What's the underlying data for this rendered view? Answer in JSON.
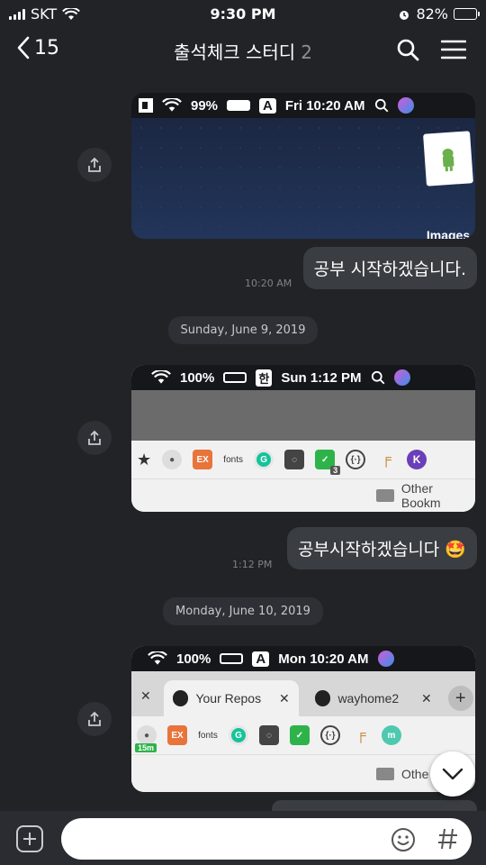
{
  "status": {
    "carrier": "SKT",
    "time": "9:30 PM",
    "battery": "82%",
    "battery_level": 0.82
  },
  "header": {
    "back_count": "15",
    "title": "출석체크 스터디",
    "member_count": "2"
  },
  "messages": [
    {
      "screenshot": {
        "menubar": {
          "battery": "99%",
          "input": "A",
          "clock": "Fri 10:20 AM"
        },
        "desktop_label": "Images"
      },
      "bubble": "공부 시작하겠습니다.",
      "time": "10:20 AM"
    },
    {
      "date": "Sunday, June 9, 2019",
      "screenshot": {
        "menubar": {
          "battery": "100%",
          "input": "한",
          "clock": "Sun 1:12 PM"
        },
        "bookmark_folder": "Other Bookm",
        "badge": "3"
      },
      "bubble": "공부시작하겠습니다 🤩",
      "time": "1:12 PM"
    },
    {
      "date": "Monday, June 10, 2019",
      "screenshot": {
        "menubar": {
          "battery": "100%",
          "input": "A",
          "clock": "Mon 10:20 AM"
        },
        "tab1": "Your Repos",
        "tab2": "wayhome2",
        "bookmark_folder": "Othe",
        "timer_badge": "15m"
      }
    }
  ],
  "composer": {
    "placeholder": ""
  },
  "colors": {
    "background": "#212327",
    "bubble": "#3a3d42",
    "battery_green": "#4cd964"
  },
  "icons": [
    "signal-icon",
    "wifi-icon",
    "alarm-icon",
    "battery-icon",
    "chevron-left-icon",
    "search-icon",
    "menu-icon",
    "share-icon",
    "chevron-down-icon",
    "plus-icon",
    "emoji-icon",
    "hashtag-icon"
  ]
}
